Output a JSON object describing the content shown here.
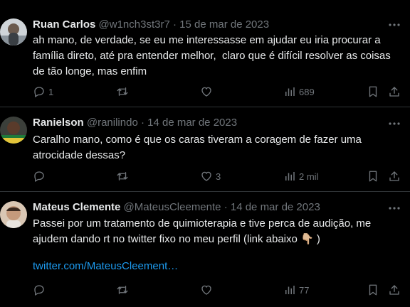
{
  "tweets": [
    {
      "name": "Ruan Carlos",
      "handle": "@w1nch3st3r7",
      "separator": "·",
      "date": "15 de mar de 2023",
      "text": "ah mano, de verdade, se eu me interessasse em ajudar eu iria procurar a família direto, até pra entender melhor,  claro que é difícil resolver as coisas de tão longe, mas enfim",
      "link": "",
      "replies": "1",
      "retweets": "",
      "likes": "",
      "views": "689"
    },
    {
      "name": "Ranielson",
      "handle": "@ranilindo",
      "separator": "·",
      "date": "14 de mar de 2023",
      "text": "Caralho mano, como é que os caras tiveram a coragem de fazer uma atrocidade dessas?",
      "link": "",
      "replies": "",
      "retweets": "",
      "likes": "3",
      "views": "2 mil"
    },
    {
      "name": "Mateus Clemente",
      "handle": "@MateusCleemente",
      "separator": "·",
      "date": "14 de mar de 2023",
      "text": "Passei por um tratamento de quimioterapia e tive perca de audição, me ajudem dando rt no twitter fixo no meu perfil (link abaixo 👇🏼 )",
      "link": "twitter.com/MateusCleement…",
      "replies": "",
      "retweets": "",
      "likes": "",
      "views": "77"
    }
  ],
  "icons": {
    "reply": "reply-icon",
    "retweet": "retweet-icon",
    "like": "heart-icon",
    "views": "views-icon",
    "bookmark": "bookmark-icon",
    "share": "share-icon",
    "more": "more-icon"
  },
  "colors": {
    "background": "#000000",
    "text": "#e7e9ea",
    "muted": "#71767b",
    "link": "#1d9bf0",
    "border": "#2f3336"
  }
}
